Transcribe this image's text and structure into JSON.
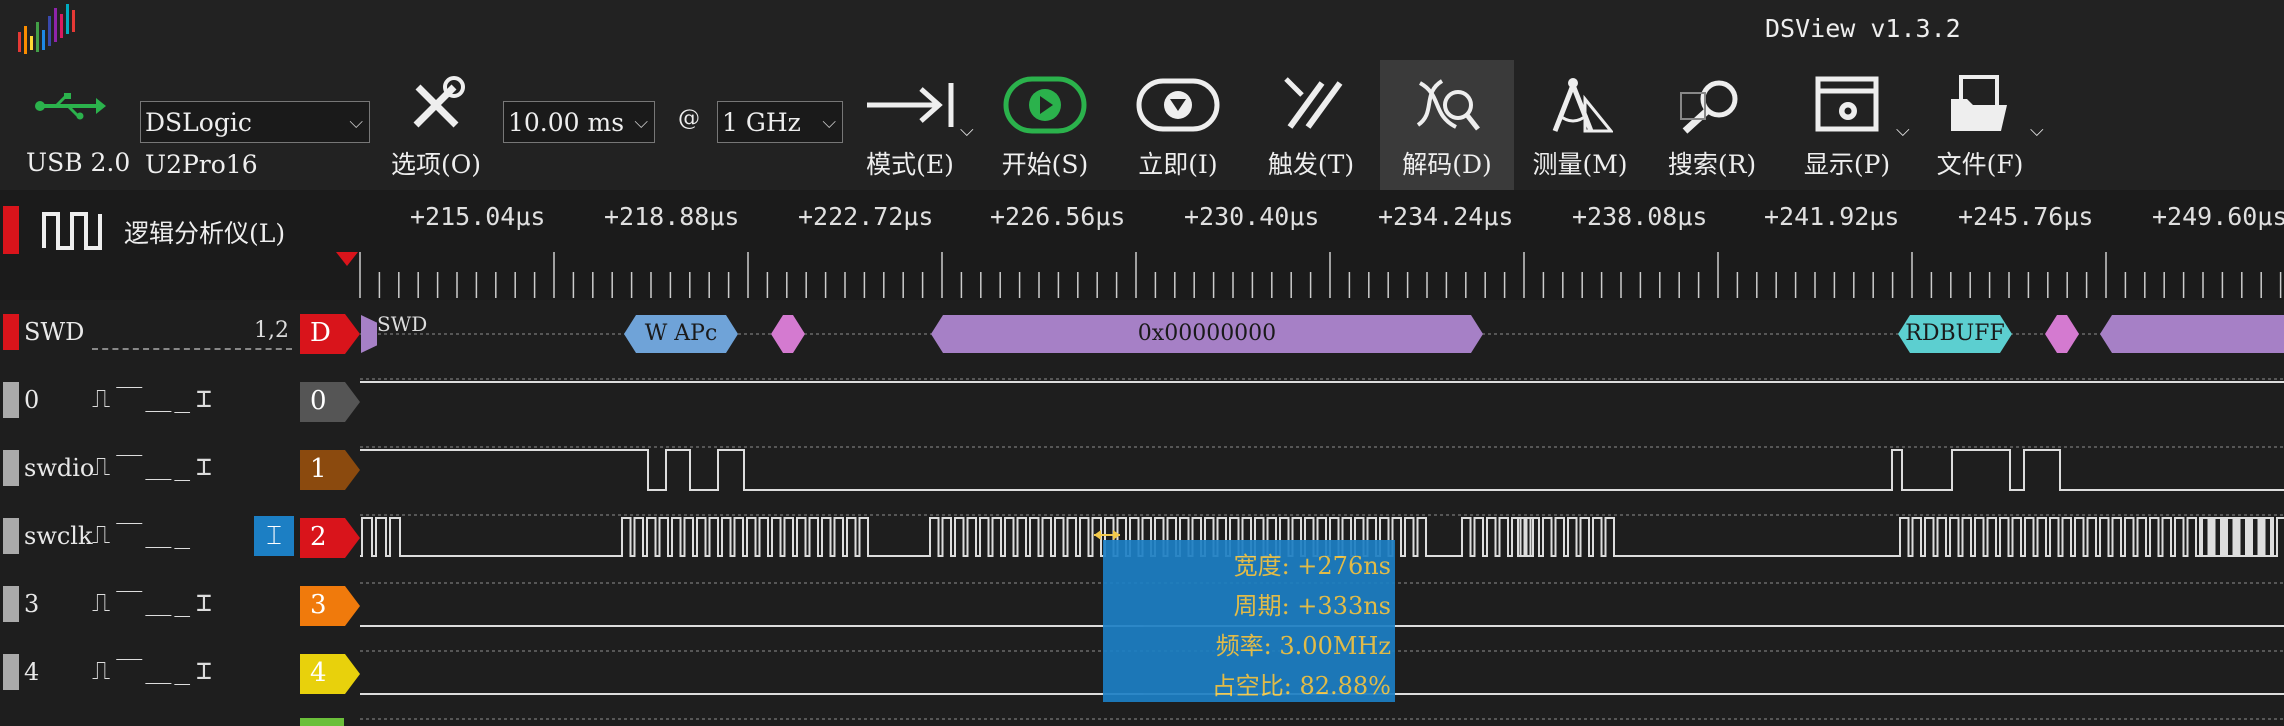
{
  "app": {
    "title": "DSView v1.3.2"
  },
  "toolbar": {
    "usb_label": "USB 2.0",
    "device": "DSLogic U2Pro16",
    "options_label": "选项(O)",
    "duration": "10.00 ms",
    "at": "@",
    "rate": "1 GHz",
    "mode_label": "模式(E)",
    "start_label": "开始(S)",
    "instant_label": "立即(I)",
    "trigger_label": "触发(T)",
    "decode_label": "解码(D)",
    "measure_label": "测量(M)",
    "search_label": "搜索(R)",
    "display_label": "显示(P)",
    "file_label": "文件(F)"
  },
  "ruler": {
    "mode_label": "逻辑分析仪(L)",
    "ticks": [
      "+215.04μs",
      "+218.88μs",
      "+222.72μs",
      "+226.56μs",
      "+230.40μs",
      "+234.24μs",
      "+238.08μs",
      "+241.92μs",
      "+245.76μs",
      "+249.60μs"
    ]
  },
  "channels": [
    {
      "name": "SWD",
      "trigger": "1,2",
      "tag": "D",
      "color": "#d9141b"
    },
    {
      "name": "0",
      "trigger": "",
      "tag": "0",
      "color": "#555555"
    },
    {
      "name": "swdio",
      "trigger": "",
      "tag": "1",
      "color": "#8b4a0e"
    },
    {
      "name": "swclk",
      "trigger": "",
      "tag": "2",
      "color": "#d9141b"
    },
    {
      "name": "3",
      "trigger": "",
      "tag": "3",
      "color": "#f07a0c"
    },
    {
      "name": "4",
      "trigger": "",
      "tag": "4",
      "color": "#e8d10c"
    }
  ],
  "decode": {
    "start_label": "SWD",
    "segments": [
      {
        "text": "W APc",
        "color": "#6fa3d8"
      },
      {
        "text": "",
        "color": "#d47ad0"
      },
      {
        "text": "0x00000000",
        "color": "#a680c6"
      },
      {
        "text": "RDBUFF",
        "color": "#5ccfd0"
      },
      {
        "text": "",
        "color": "#d47ad0"
      },
      {
        "text": "",
        "color": "#a680c6"
      }
    ]
  },
  "measurement": {
    "width": "宽度: +276ns",
    "period": "周期: +333ns",
    "freq": "频率: 3.00MHz",
    "duty": "占空比: 82.88%"
  }
}
